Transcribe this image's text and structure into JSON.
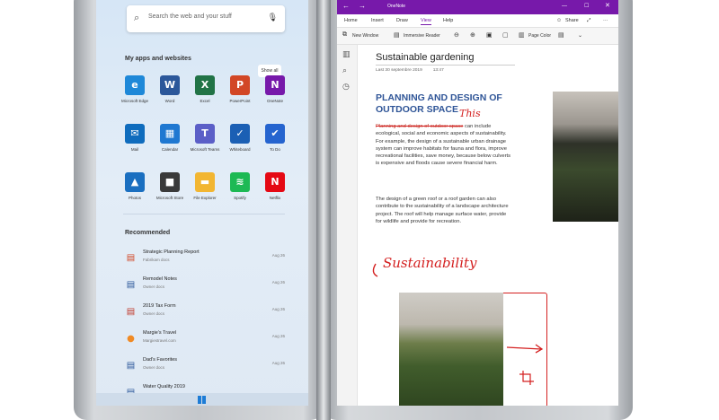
{
  "start_menu": {
    "search_placeholder": "Search the web and your stuff",
    "apps_title": "My apps and websites",
    "show_all": "Show all",
    "apps": [
      {
        "label": "Microsoft Edge",
        "icon": "edge-icon",
        "color": "#1e88d8",
        "glyph": "e"
      },
      {
        "label": "Word",
        "icon": "word-icon",
        "color": "#2b579a",
        "glyph": "W"
      },
      {
        "label": "Excel",
        "icon": "excel-icon",
        "color": "#217346",
        "glyph": "X"
      },
      {
        "label": "PowerPoint",
        "icon": "powerpoint-icon",
        "color": "#d24726",
        "glyph": "P"
      },
      {
        "label": "OneNote",
        "icon": "onenote-icon",
        "color": "#7719aa",
        "glyph": "N"
      },
      {
        "label": "Mail",
        "icon": "mail-icon",
        "color": "#0f6cbd",
        "glyph": "✉"
      },
      {
        "label": "Calendar",
        "icon": "calendar-icon",
        "color": "#1f78d1",
        "glyph": "▦"
      },
      {
        "label": "Microsoft Teams",
        "icon": "teams-icon",
        "color": "#5b5fc7",
        "glyph": "T"
      },
      {
        "label": "Whiteboard",
        "icon": "whiteboard-icon",
        "color": "#1b5fb4",
        "glyph": "✓"
      },
      {
        "label": "To Do",
        "icon": "todo-icon",
        "color": "#2564cf",
        "glyph": "✔"
      },
      {
        "label": "Photos",
        "icon": "photos-icon",
        "color": "#1a6fc0",
        "glyph": "▲"
      },
      {
        "label": "Microsoft Store",
        "icon": "store-icon",
        "color": "#3a3a3a",
        "glyph": "■"
      },
      {
        "label": "File Explorer",
        "icon": "file-explorer-icon",
        "color": "#f2b632",
        "glyph": "▬"
      },
      {
        "label": "Spotify",
        "icon": "spotify-icon",
        "color": "#1db954",
        "glyph": "≋"
      },
      {
        "label": "Netflix",
        "icon": "netflix-icon",
        "color": "#e50914",
        "glyph": "N"
      }
    ],
    "recommended_title": "Recommended",
    "recommended": [
      {
        "title": "Strategic Planning Report",
        "sub": "Fabrikam docs",
        "date": "Aug 26",
        "icon": "powerpoint-file-icon",
        "color": "#d24726",
        "glyph": "▤"
      },
      {
        "title": "Remodel Notes",
        "sub": "Owner docs",
        "date": "Aug 26",
        "icon": "document-file-icon",
        "color": "#2b579a",
        "glyph": "▤"
      },
      {
        "title": "2019 Tax Form",
        "sub": "Owner docs",
        "date": "Aug 26",
        "icon": "pdf-file-icon",
        "color": "#c0392b",
        "glyph": "▤"
      },
      {
        "title": "Margie's Travel",
        "sub": "Margiestravel.com",
        "date": "Aug 26",
        "icon": "website-icon",
        "color": "#f08a24",
        "glyph": "●"
      },
      {
        "title": "Dad's Favorites",
        "sub": "Owner docs",
        "date": "Aug 26",
        "icon": "document-file-icon",
        "color": "#2b579a",
        "glyph": "▤"
      },
      {
        "title": "Water Quality 2019",
        "sub": "",
        "date": "",
        "icon": "document-file-icon",
        "color": "#2b579a",
        "glyph": "▤"
      }
    ]
  },
  "onenote": {
    "title": "OneNote",
    "menu": [
      "Home",
      "Insert",
      "Draw",
      "View",
      "Help"
    ],
    "active_menu": "View",
    "toolbar": {
      "new_window": "New Window",
      "immersive_reader": "Immersive Reader",
      "page_color": "Page Color"
    },
    "titlebar_buttons": {
      "share": "Share"
    },
    "page": {
      "title": "Sustainable gardening",
      "date": "Last 30 septembre 2019",
      "time": "13:47",
      "heading": "PLANNING AND DESIGN OF OUTDOOR SPACE",
      "struck_text": "Planning and design of outdoor space",
      "inked_word": "This",
      "para1_rest": "can include ecological, social and economic aspects of sustainability. For example, the design of a sustainable urban drainage system can improve habitats for fauna and flora, improve recreational facilities, save money, because below culverts is expensive and floods cause severe financial harm.",
      "para2": "The design of a green roof or a roof garden can also contribute to the sustainability of a landscape architecture project. The roof will help manage surface water, provide for wildlife and provide for recreation.",
      "ink_heading": "Sustainability"
    }
  }
}
